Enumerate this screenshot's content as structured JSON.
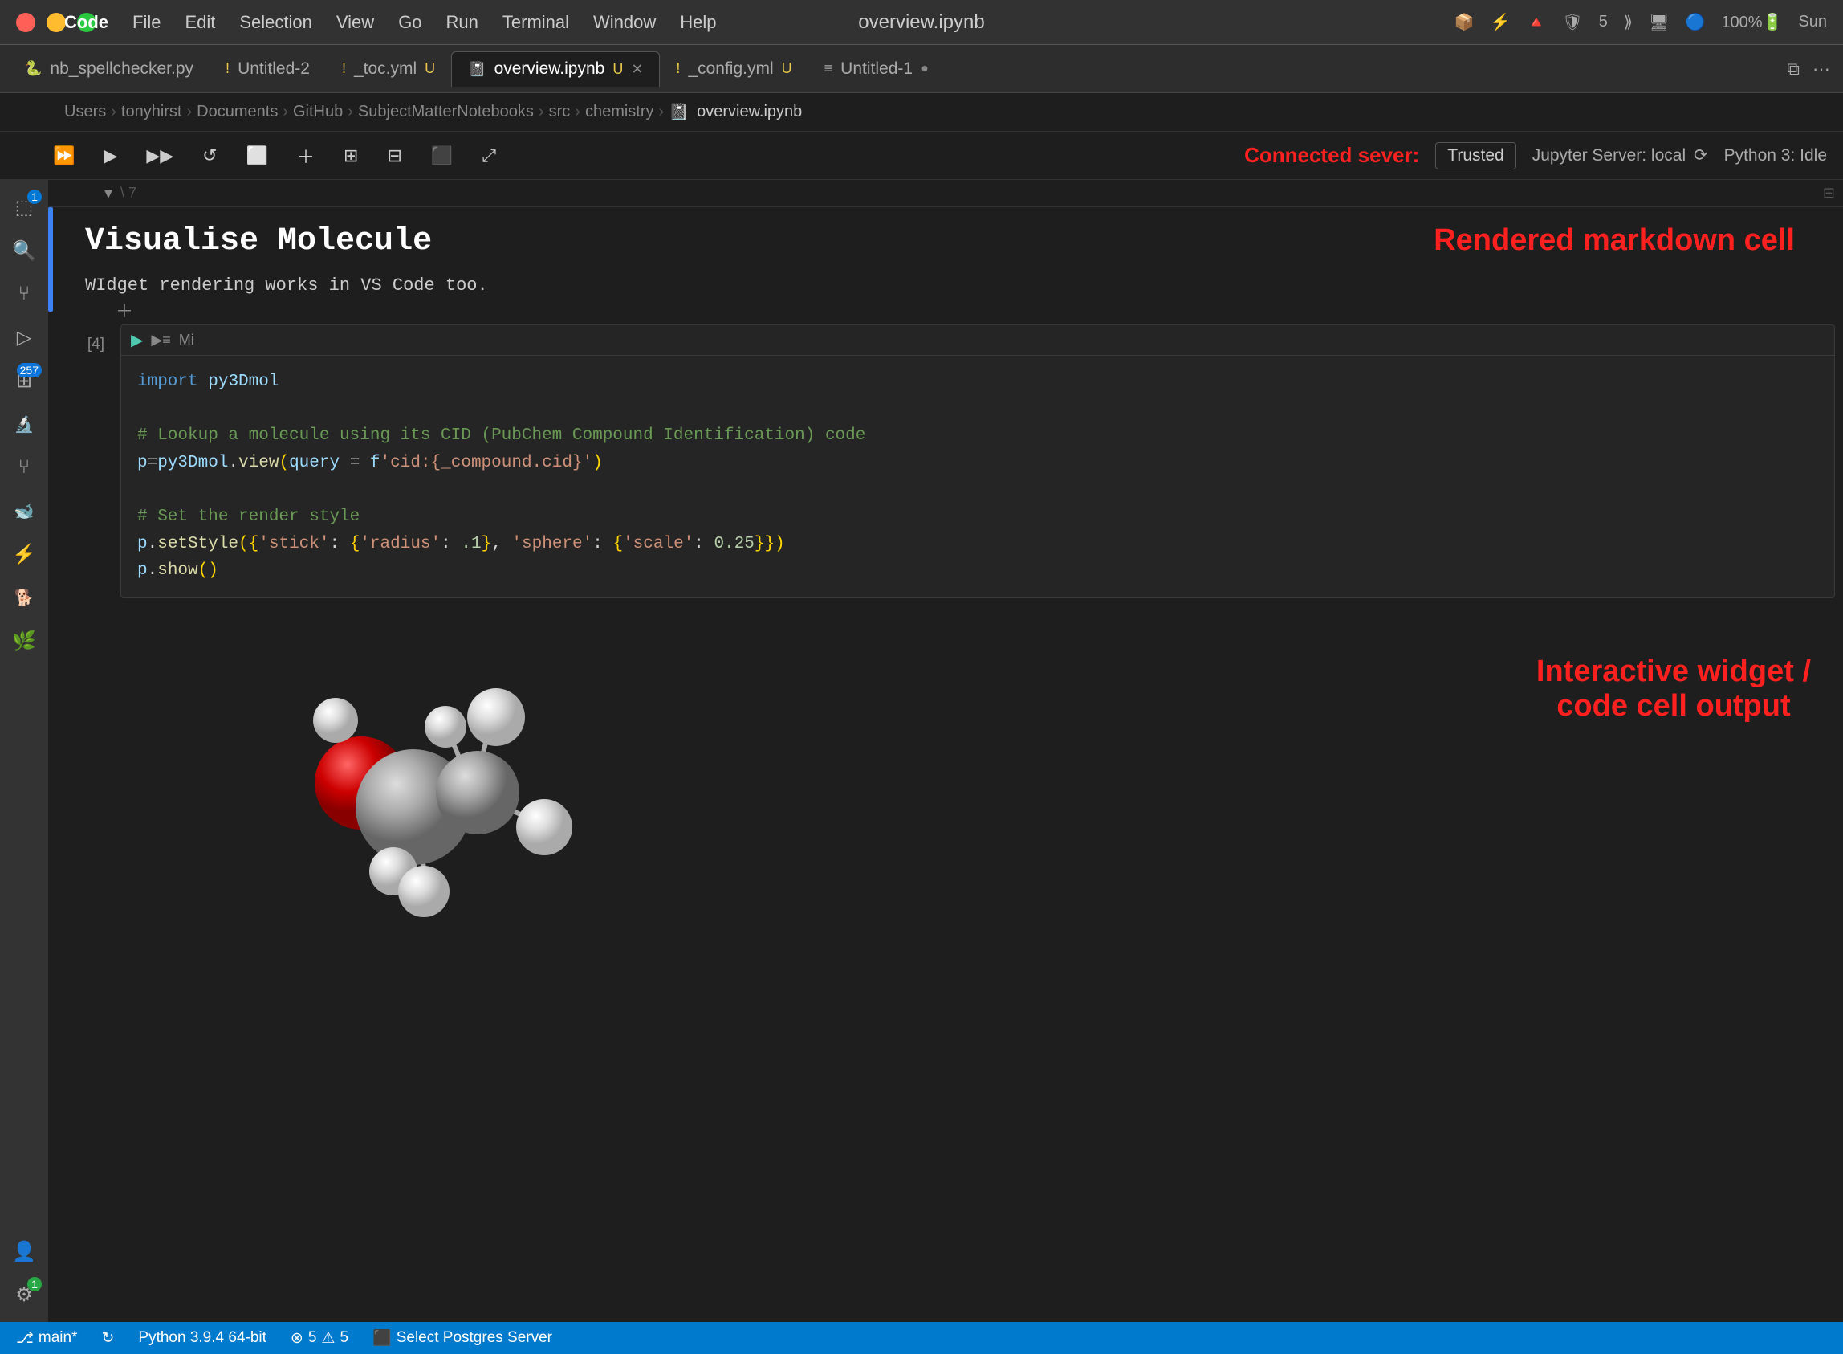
{
  "window": {
    "title": "overview.ipynb",
    "app_name": "Code"
  },
  "menu": {
    "items": [
      "Code",
      "File",
      "Edit",
      "Selection",
      "View",
      "Go",
      "Run",
      "Terminal",
      "Window",
      "Help"
    ]
  },
  "tabs": [
    {
      "id": "nb_spellchecker",
      "label": "nb_spellchecker.py",
      "icon": "🐍",
      "modified": false,
      "active": false
    },
    {
      "id": "untitled2",
      "label": "Untitled-2",
      "icon": "!",
      "modified": false,
      "active": false
    },
    {
      "id": "toc",
      "label": "_toc.yml",
      "icon": "!",
      "modified": true,
      "active": false,
      "suffix": "U"
    },
    {
      "id": "overview",
      "label": "overview.ipynb",
      "icon": "📓",
      "modified": true,
      "active": true,
      "suffix": "U"
    },
    {
      "id": "config",
      "label": "_config.yml",
      "icon": "!",
      "modified": true,
      "active": false,
      "suffix": "U"
    },
    {
      "id": "untitled1",
      "label": "Untitled-1",
      "icon": "≡",
      "modified": true,
      "active": false
    }
  ],
  "breadcrumb": {
    "items": [
      "Users",
      "tonyhirst",
      "Documents",
      "GitHub",
      "SubjectMatterNotebooks",
      "src",
      "chemistry",
      "overview.ipynb"
    ]
  },
  "toolbar": {
    "connected_server_label": "Connected sever:",
    "trusted_label": "Trusted",
    "jupyter_server_label": "Jupyter Server: local",
    "python_label": "Python 3: Idle"
  },
  "activity_bar": {
    "icons": [
      {
        "id": "explorer",
        "symbol": "⬚",
        "badge": "1"
      },
      {
        "id": "search",
        "symbol": "🔍"
      },
      {
        "id": "source-control",
        "symbol": "⑂"
      },
      {
        "id": "run-debug",
        "symbol": "▷"
      },
      {
        "id": "extensions",
        "symbol": "⊞",
        "badge": "257",
        "badge_color": "blue"
      },
      {
        "id": "jupyter",
        "symbol": "🔬"
      },
      {
        "id": "git-graph",
        "symbol": "⑂"
      },
      {
        "id": "docker",
        "symbol": "🐳"
      },
      {
        "id": "remote",
        "symbol": "⚡"
      },
      {
        "id": "datadog",
        "symbol": "🐕"
      },
      {
        "id": "globe",
        "symbol": "🌿"
      }
    ],
    "bottom_icons": [
      {
        "id": "account",
        "symbol": "👤"
      },
      {
        "id": "settings",
        "symbol": "⚙",
        "badge": "1"
      }
    ]
  },
  "notebook": {
    "cells": [
      {
        "type": "markdown",
        "collapsed": true,
        "content": {
          "heading": "Visualise Molecule",
          "paragraph": "WIdget rendering works in VS Code too."
        }
      },
      {
        "type": "code",
        "number": "[4]",
        "code_lines": [
          {
            "type": "import",
            "text": "import py3Dmol"
          },
          {
            "type": "blank"
          },
          {
            "type": "comment",
            "text": "# Lookup a molecule using its CID (PubChem Compound Identification) code"
          },
          {
            "type": "code",
            "text": "p=py3Dmol.view(query = f'cid:{_compound.cid}')"
          },
          {
            "type": "blank"
          },
          {
            "type": "comment",
            "text": "# Set the render style"
          },
          {
            "type": "code",
            "text": "p.setStyle({'stick': {'radius': .1}, 'sphere': {'scale': 0.25}})"
          },
          {
            "type": "code",
            "text": "p.show()"
          }
        ]
      }
    ]
  },
  "annotations": {
    "rendered_markdown": "Rendered markdown cell",
    "interactive_widget_line1": "Interactive widget /",
    "interactive_widget_line2": "code cell output"
  },
  "statusbar": {
    "branch_icon": "⎇",
    "branch": "main*",
    "sync_icon": "↻",
    "python_version": "Python 3.9.4 64-bit",
    "errors": "⊗ 5",
    "warnings": "⚠ 5",
    "db_label": "Select Postgres Server"
  }
}
